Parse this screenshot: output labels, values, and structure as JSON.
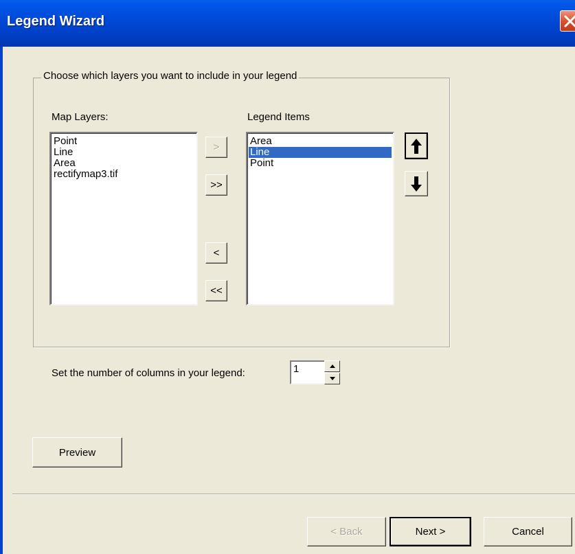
{
  "window": {
    "title": "Legend Wizard"
  },
  "group": {
    "label": "Choose which layers you want to include in your legend"
  },
  "map_layers": {
    "label": "Map Layers:",
    "items": [
      {
        "label": "Point"
      },
      {
        "label": "Line"
      },
      {
        "label": "Area"
      },
      {
        "label": "rectifymap3.tif"
      }
    ]
  },
  "legend_items": {
    "label": "Legend Items",
    "items": [
      {
        "label": "Area",
        "selected": false
      },
      {
        "label": "Line",
        "selected": true
      },
      {
        "label": "Point",
        "selected": false
      }
    ]
  },
  "transfer_buttons": {
    "add": ">",
    "add_all": ">>",
    "remove": "<",
    "remove_all": "<<"
  },
  "columns": {
    "label": "Set the number of columns in your legend:",
    "value": "1"
  },
  "buttons": {
    "preview": "Preview",
    "back": "< Back",
    "next": "Next >",
    "cancel": "Cancel"
  },
  "colors": {
    "titlebar": "#0054e3",
    "selection": "#316ac5",
    "dialog_bg": "#ece9d8"
  },
  "icons": {
    "close": "close-icon",
    "move_up": "arrow-up-icon",
    "move_down": "arrow-down-icon",
    "spin_up": "spin-up-icon",
    "spin_down": "spin-down-icon"
  }
}
